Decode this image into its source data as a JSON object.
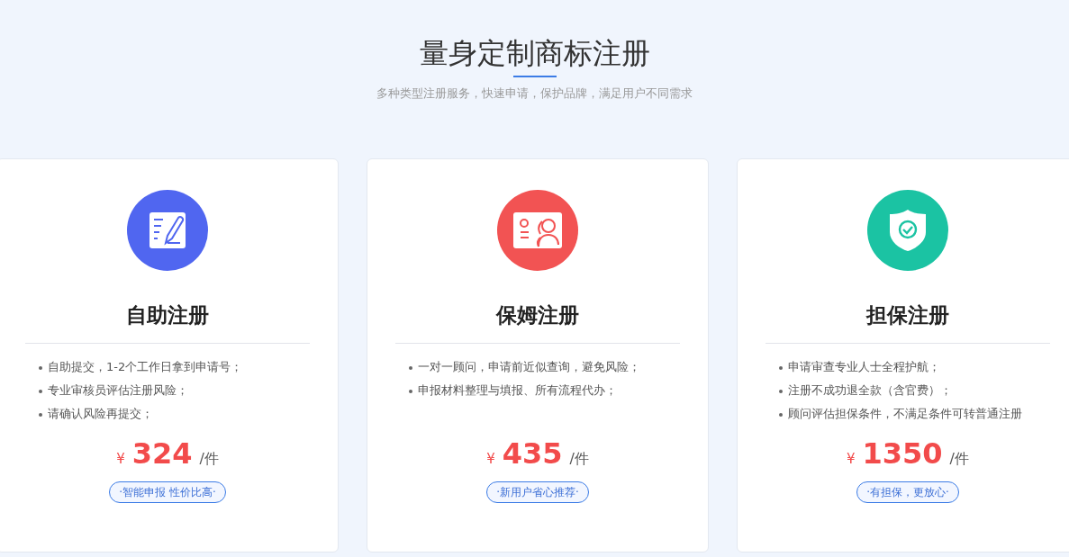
{
  "header": {
    "title": "量身定制商标注册",
    "subtitle": "多种类型注册服务，快速申请，保护品牌，满足用户不同需求"
  },
  "plans": [
    {
      "kind": "pen",
      "color": "#5066f0",
      "name": "自助注册",
      "features": [
        "自助提交，1-2个工作日拿到申请号；",
        "专业审核员评估注册风险；",
        "请确认风险再提交；"
      ],
      "currency": "¥",
      "price": "324",
      "unit": "/件",
      "tag": "·智能申报 性价比高·"
    },
    {
      "kind": "idcard",
      "color": "#f25353",
      "name": "保姆注册",
      "features": [
        "一对一顾问，申请前近似查询，避免风险；",
        "申报材料整理与填报、所有流程代办；"
      ],
      "currency": "¥",
      "price": "435",
      "unit": "/件",
      "tag": "·新用户省心推荐·"
    },
    {
      "kind": "shield",
      "color": "#1bc3a3",
      "name": "担保注册",
      "features": [
        "申请审查专业人士全程护航；",
        "注册不成功退全款（含官费）；",
        "顾问评估担保条件，不满足条件可转普通注册"
      ],
      "currency": "¥",
      "price": "1350",
      "unit": "/件",
      "tag": "·有担保，更放心·"
    }
  ]
}
